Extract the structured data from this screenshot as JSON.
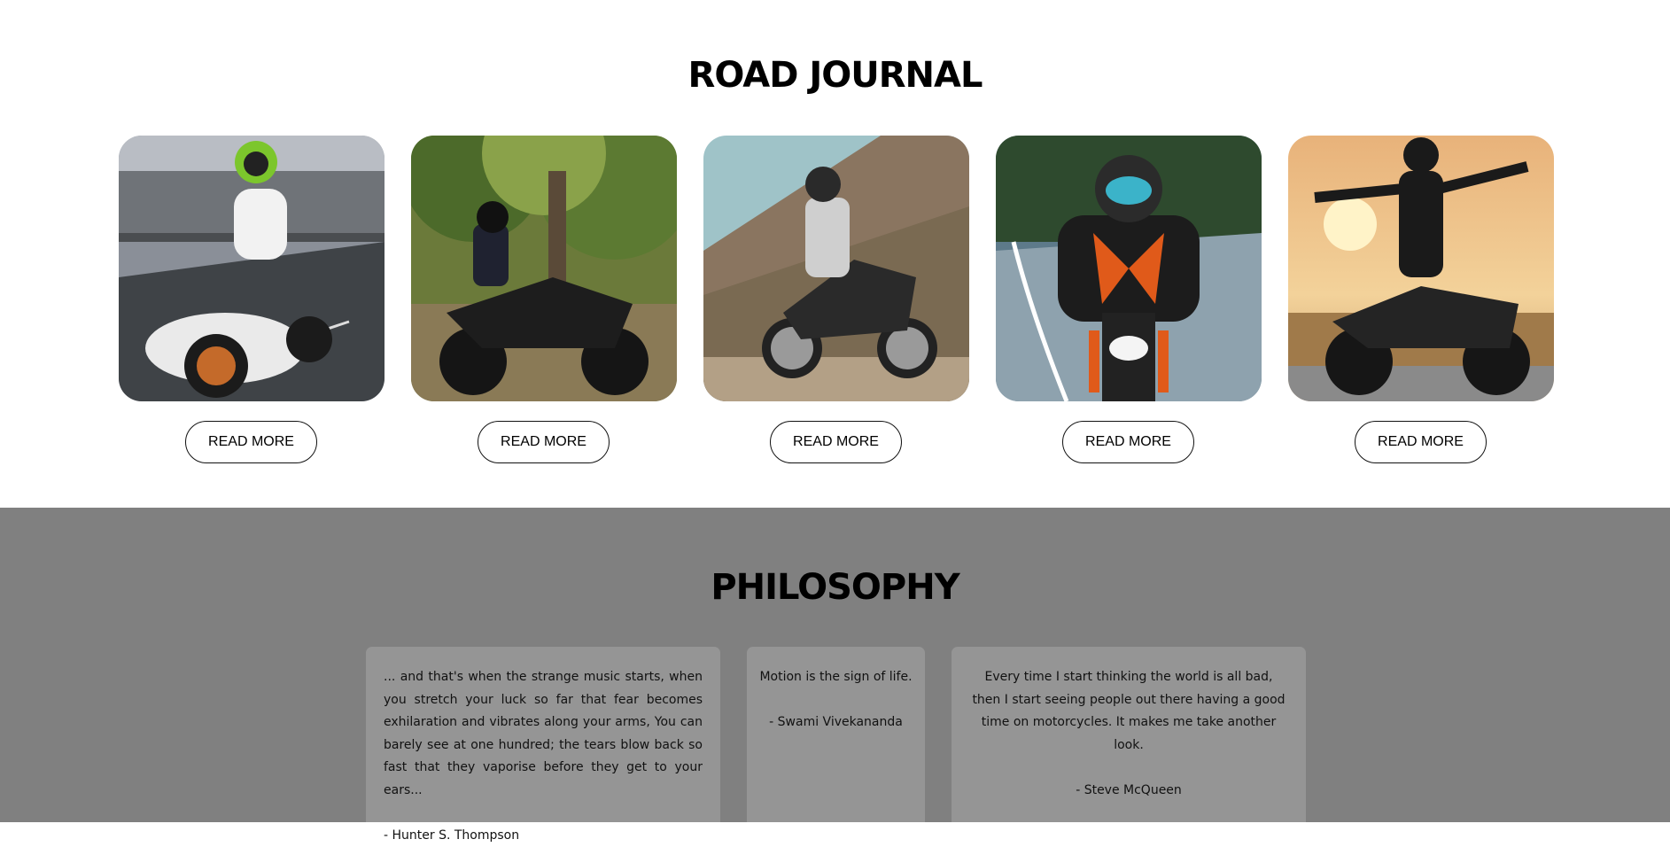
{
  "road_journal": {
    "title": "ROAD JOURNAL",
    "cards": [
      {
        "image": "rider-on-white-sportbike-photo",
        "button_label": "READ MORE"
      },
      {
        "image": "rider-beside-black-naked-bike-photo",
        "button_label": "READ MORE"
      },
      {
        "image": "rider-on-cafe-racer-hillside-photo",
        "button_label": "READ MORE"
      },
      {
        "image": "rider-on-orange-naked-bike-road-photo",
        "button_label": "READ MORE"
      },
      {
        "image": "rider-standing-on-bike-sunset-photo",
        "button_label": "READ MORE"
      }
    ]
  },
  "philosophy": {
    "title": "PHILOSOPHY",
    "quotes": [
      {
        "text": "... and that's when the strange music starts, when you stretch your luck so far that fear becomes exhilaration and vibrates along your arms, You can barely see at one hundred; the tears blow back so fast that they vaporise before they get to your ears...",
        "author": "- Hunter S. Thompson"
      },
      {
        "text": "Motion is the sign of life.",
        "author": "- Swami Vivekananda"
      },
      {
        "text": "Every time I start thinking the world is all bad, then I start seeing people out there having a good time on motorcycles. It makes me take another look.",
        "author": "- Steve McQueen"
      }
    ]
  },
  "colors": {
    "journal_bg": "#ffffff",
    "philosophy_bg": "#808080",
    "quote_card_bg": "#959595"
  }
}
